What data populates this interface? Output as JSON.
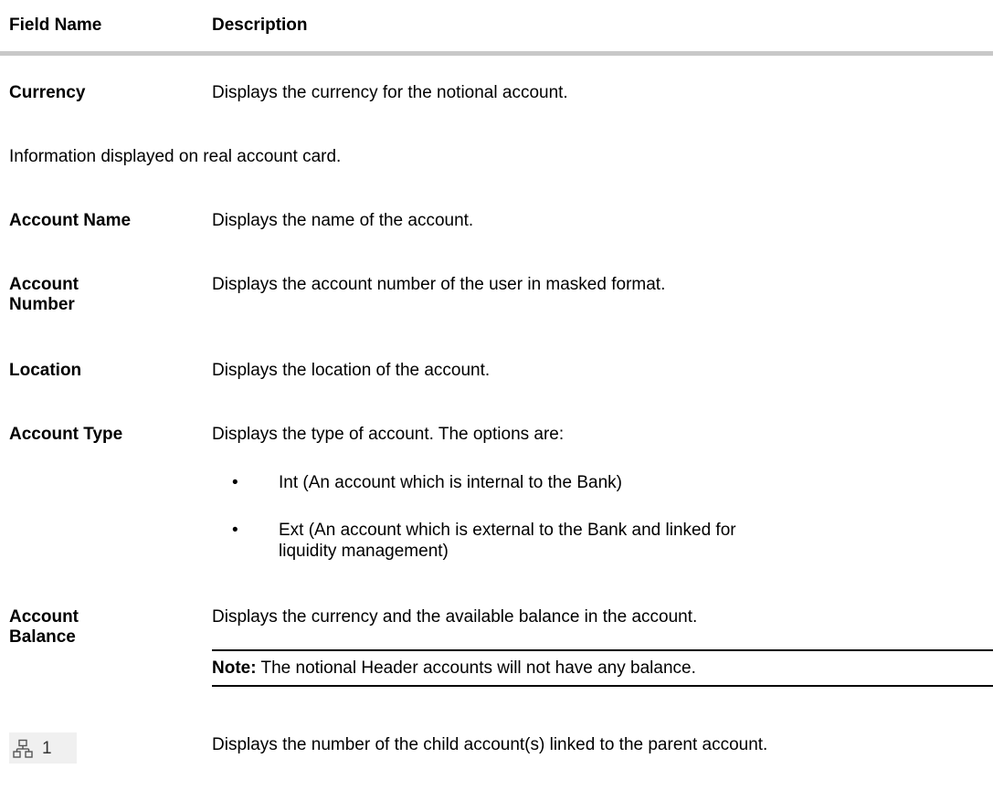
{
  "header": {
    "field_name": "Field Name",
    "description": "Description"
  },
  "rows": {
    "currency": {
      "label": "Currency",
      "desc": "Displays the currency for the notional account."
    },
    "intro": "Information displayed on real account card.",
    "account_name": {
      "label": "Account Name",
      "desc": "Displays the name of the account."
    },
    "account_number": {
      "label_line1": "Account",
      "label_line2": "Number",
      "desc": "Displays the account number of the user in masked format."
    },
    "location": {
      "label": "Location",
      "desc": "Displays the location of the account."
    },
    "account_type": {
      "label": "Account Type",
      "desc": "Displays the type of account. The options are:",
      "bullets": [
        {
          "line1": "Int (An account which is internal to the Bank)"
        },
        {
          "line1": "Ext (An account which is external to the Bank and linked for",
          "line2": "liquidity management)"
        }
      ]
    },
    "account_balance": {
      "label_line1": "Account",
      "label_line2": "Balance",
      "desc": "Displays the currency and the available balance in the account.",
      "note_label": "Note:",
      "note_text": " The notional Header accounts will not have any balance."
    },
    "child_accounts": {
      "icon": "hierarchy-icon",
      "count": "1",
      "desc": "Displays the number of the child account(s) linked to the parent account."
    }
  }
}
